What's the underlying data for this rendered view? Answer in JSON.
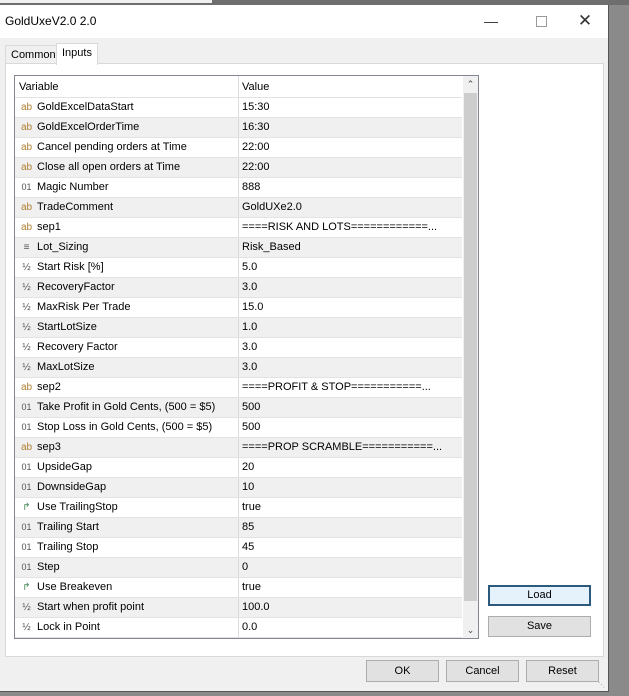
{
  "window": {
    "title": "GoldUxeV2.0 2.0"
  },
  "tabs": [
    {
      "label": "Common"
    },
    {
      "label": "Inputs",
      "active": true
    }
  ],
  "table": {
    "headers": {
      "variable": "Variable",
      "value": "Value"
    },
    "rows": [
      {
        "icon": "ab",
        "type": "string",
        "name": "GoldExcelDataStart",
        "value": "15:30"
      },
      {
        "icon": "ab",
        "type": "string",
        "name": "GoldExcelOrderTime",
        "value": "16:30"
      },
      {
        "icon": "ab",
        "type": "string",
        "name": "Cancel pending orders at Time",
        "value": "22:00"
      },
      {
        "icon": "ab",
        "type": "string",
        "name": "Close all open orders at Time",
        "value": "22:00"
      },
      {
        "icon": "01",
        "type": "int",
        "name": "Magic Number",
        "value": "888"
      },
      {
        "icon": "ab",
        "type": "string",
        "name": "TradeComment",
        "value": "GoldUXe2.0"
      },
      {
        "icon": "ab",
        "type": "string",
        "name": "sep1",
        "value": "====RISK AND LOTS============..."
      },
      {
        "icon": "≡",
        "type": "enum",
        "name": "Lot_Sizing",
        "value": "Risk_Based"
      },
      {
        "icon": "½",
        "type": "double",
        "name": "Start Risk [%]",
        "value": "5.0"
      },
      {
        "icon": "½",
        "type": "double",
        "name": "RecoveryFactor",
        "value": "3.0"
      },
      {
        "icon": "½",
        "type": "double",
        "name": "MaxRisk Per Trade",
        "value": "15.0"
      },
      {
        "icon": "½",
        "type": "double",
        "name": "StartLotSize",
        "value": "1.0"
      },
      {
        "icon": "½",
        "type": "double",
        "name": "Recovery Factor",
        "value": "3.0"
      },
      {
        "icon": "½",
        "type": "double",
        "name": "MaxLotSize",
        "value": "3.0"
      },
      {
        "icon": "ab",
        "type": "string",
        "name": "sep2",
        "value": "====PROFIT & STOP===========..."
      },
      {
        "icon": "01",
        "type": "int",
        "name": "Take Profit in Gold Cents, (500 = $5)",
        "value": "500"
      },
      {
        "icon": "01",
        "type": "int",
        "name": "Stop Loss in Gold Cents, (500 = $5)",
        "value": "500"
      },
      {
        "icon": "ab",
        "type": "string",
        "name": "sep3",
        "value": "====PROP SCRAMBLE===========..."
      },
      {
        "icon": "01",
        "type": "int",
        "name": "UpsideGap",
        "value": "20"
      },
      {
        "icon": "01",
        "type": "int",
        "name": "DownsideGap",
        "value": "10"
      },
      {
        "icon": "↱",
        "type": "bool",
        "name": "Use TrailingStop",
        "value": "true"
      },
      {
        "icon": "01",
        "type": "int",
        "name": "Trailing Start",
        "value": "85"
      },
      {
        "icon": "01",
        "type": "int",
        "name": "Trailing Stop",
        "value": "45"
      },
      {
        "icon": "01",
        "type": "int",
        "name": "Step",
        "value": "0"
      },
      {
        "icon": "↱",
        "type": "bool",
        "name": "Use Breakeven",
        "value": "true"
      },
      {
        "icon": "½",
        "type": "double",
        "name": "Start when profit point",
        "value": "100.0"
      },
      {
        "icon": "½",
        "type": "double",
        "name": "Lock in Point",
        "value": "0.0"
      }
    ]
  },
  "side_buttons": {
    "load": "Load",
    "save": "Save"
  },
  "footer_buttons": {
    "ok": "OK",
    "cancel": "Cancel",
    "reset": "Reset"
  }
}
